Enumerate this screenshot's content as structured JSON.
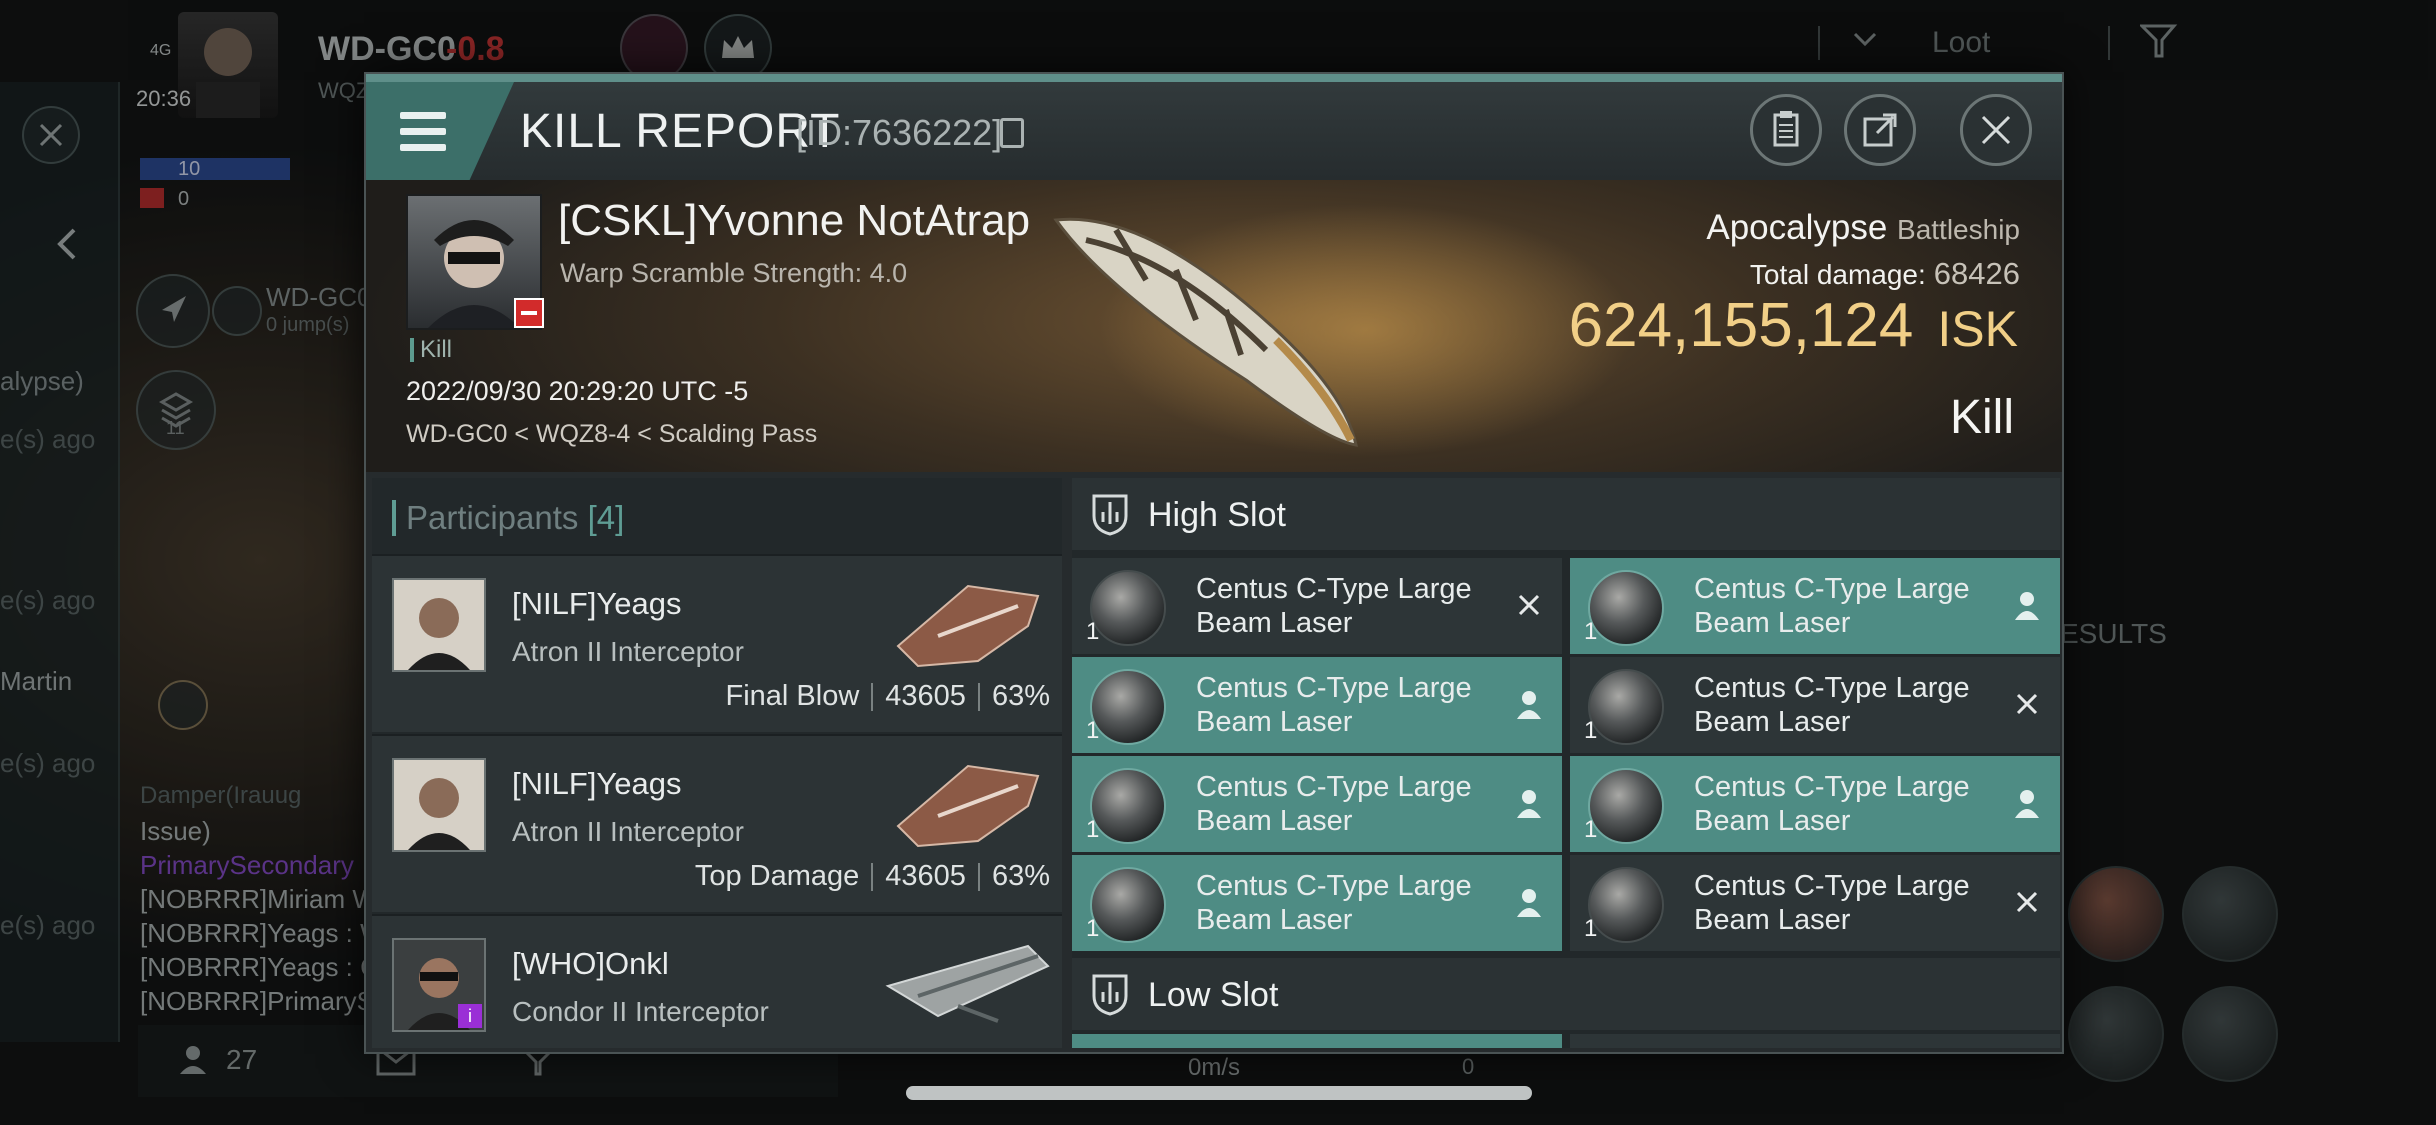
{
  "hud": {
    "system_name": "WD-GC0",
    "security_status": "-0.8",
    "signal": "4G",
    "time": "20:36",
    "fleet_blue_count": "10",
    "fleet_red_count": "0",
    "route_target": "WD-GC0",
    "route_jumps": "0 jump(s)",
    "stack_count": "11",
    "loot_label": "Loot",
    "left_clip_1": "alypse)",
    "left_clip_2": "e(s) ago",
    "left_clip_3": "e(s) ago",
    "left_clip_4": "Martin",
    "left_clip_5": "e(s) ago",
    "left_clip_6": "e(s) ago",
    "right_clip": "ESULTS",
    "chat": [
      "Issue)",
      "PrimarySecondary",
      "[NOBRRR]Miriam Wo",
      "[NOBRRR]Yeags : W",
      "[NOBRRR]Yeags : Ca",
      "[NOBRRR]PrimarySe"
    ],
    "chat_top": "Damper(Irauug",
    "people_count": "27",
    "speed": "0m/s",
    "speed_right": "0"
  },
  "report": {
    "title": "KILL REPORT",
    "id_label": "[ID:7636222]",
    "victim": {
      "name": "[CSKL]Yvonne NotAtrap",
      "sub": "Warp Scramble Strength: 4.0",
      "tag": "Kill",
      "datetime": "2022/09/30 20:29:20 UTC -5",
      "location": "WD-GC0 < WQZ8-4 < Scalding Pass"
    },
    "ship": {
      "name": "Apocalypse",
      "class": "Battleship",
      "total_damage_label": "Total damage:",
      "total_damage": "68426",
      "value": "624,155,124",
      "currency": "ISK",
      "outcome": "Kill"
    },
    "participants_label": "Participants",
    "participants_count": "[4]",
    "participants": [
      {
        "name": "[NILF]Yeags",
        "ship": "Atron II Interceptor",
        "role": "Final Blow",
        "damage": "43605",
        "pct": "63%"
      },
      {
        "name": "[NILF]Yeags",
        "ship": "Atron II Interceptor",
        "role": "Top Damage",
        "damage": "43605",
        "pct": "63%"
      },
      {
        "name": "[WHO]Onkl",
        "ship": "Condor II Interceptor",
        "role": "",
        "damage": "",
        "pct": ""
      }
    ],
    "high_slot_label": "High Slot",
    "low_slot_label": "Low Slot",
    "high_slots": [
      {
        "name": "Centus C-Type Large Beam Laser",
        "qty": "1",
        "state": "destroyed"
      },
      {
        "name": "Centus C-Type Large Beam Laser",
        "qty": "1",
        "state": "dropped"
      },
      {
        "name": "Centus C-Type Large Beam Laser",
        "qty": "1",
        "state": "dropped"
      },
      {
        "name": "Centus C-Type Large Beam Laser",
        "qty": "1",
        "state": "destroyed"
      },
      {
        "name": "Centus C-Type Large Beam Laser",
        "qty": "1",
        "state": "dropped"
      },
      {
        "name": "Centus C-Type Large Beam Laser",
        "qty": "1",
        "state": "dropped"
      },
      {
        "name": "Centus C-Type Large Beam Laser",
        "qty": "1",
        "state": "dropped"
      },
      {
        "name": "Centus C-Type Large Beam Laser",
        "qty": "1",
        "state": "destroyed"
      }
    ],
    "colors": {
      "accent": "#5f9d94",
      "isk": "#f1cf87",
      "dropped_bg": "#4e8c84"
    }
  }
}
